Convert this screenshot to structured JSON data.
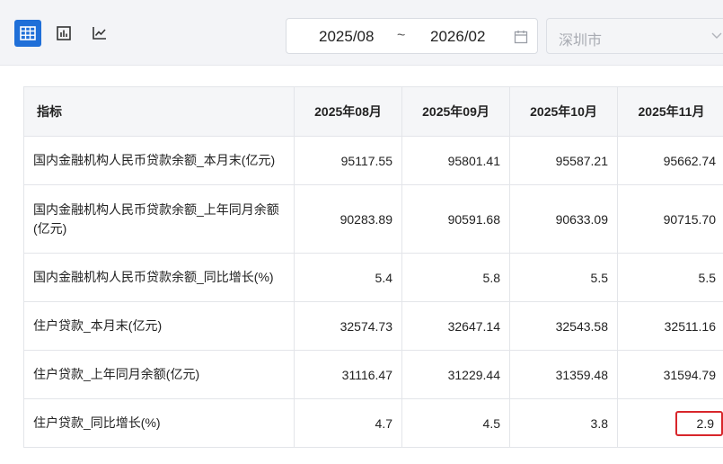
{
  "toolbar": {
    "views": [
      {
        "name": "table-view",
        "icon": "table-grid-icon",
        "active": true
      },
      {
        "name": "bar-chart-view",
        "icon": "bar-chart-icon",
        "active": false
      },
      {
        "name": "line-chart-view",
        "icon": "line-chart-icon",
        "active": false
      }
    ],
    "date_range": {
      "start": "2025/08",
      "separator": "~",
      "end": "2026/02",
      "icon": "calendar-icon"
    },
    "city_select": {
      "value": "深圳市",
      "icon": "chevron-down-icon"
    }
  },
  "colors": {
    "accent": "#1f6fd8",
    "highlight_border": "#d8262b",
    "header_bg": "#f5f6f8",
    "topbar_bg": "#f3f4f7"
  },
  "table": {
    "columns": [
      "指标",
      "2025年08月",
      "2025年09月",
      "2025年10月",
      "2025年11月"
    ],
    "rows": [
      {
        "label": "国内金融机构人民币贷款余额_本月末(亿元)",
        "values": [
          "95117.55",
          "95801.41",
          "95587.21",
          "95662.74"
        ]
      },
      {
        "label": "国内金融机构人民币贷款余额_上年同月余额(亿元)",
        "values": [
          "90283.89",
          "90591.68",
          "90633.09",
          "90715.70"
        ]
      },
      {
        "label": "国内金融机构人民币贷款余额_同比增长(%)",
        "values": [
          "5.4",
          "5.8",
          "5.5",
          "5.5"
        ]
      },
      {
        "label": "住户贷款_本月末(亿元)",
        "values": [
          "32574.73",
          "32647.14",
          "32543.58",
          "32511.16"
        ]
      },
      {
        "label": "住户贷款_上年同月余额(亿元)",
        "values": [
          "31116.47",
          "31229.44",
          "31359.48",
          "31594.79"
        ]
      },
      {
        "label": "住户贷款_同比增长(%)",
        "values": [
          "4.7",
          "4.5",
          "3.8",
          "2.9"
        ]
      }
    ]
  }
}
